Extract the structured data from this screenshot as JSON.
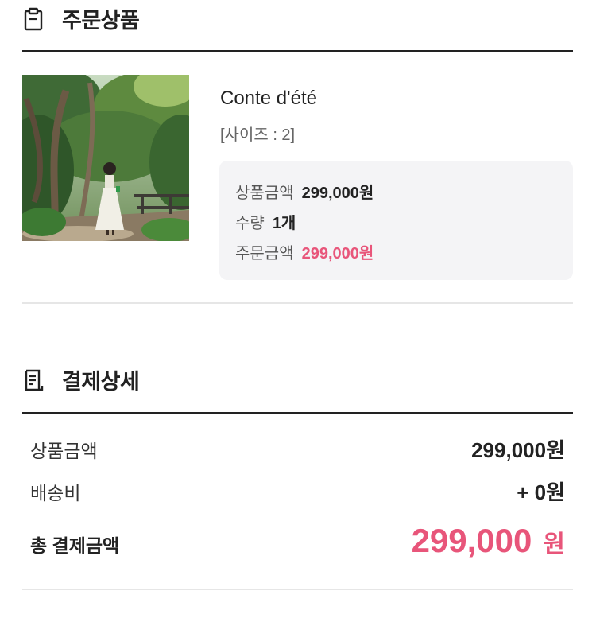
{
  "order_section": {
    "title": "주문상품",
    "icon": "clipboard-icon"
  },
  "item": {
    "name": "Conte d'été",
    "option": "[사이즈 : 2]",
    "image": "product-photo",
    "product_price_label": "상품금액",
    "product_price": "299,000원",
    "quantity_label": "수량",
    "quantity": "1개",
    "order_price_label": "주문금액",
    "order_price": "299,000원"
  },
  "payment_section": {
    "title": "결제상세",
    "icon": "receipt-icon",
    "product_price_label": "상품금액",
    "product_price": "299,000원",
    "shipping_label": "배송비",
    "shipping": "+ 0원",
    "total_label": "총 결제금액",
    "total_amount": "299,000",
    "total_unit": "원"
  },
  "colors": {
    "accent": "#e8557a",
    "text": "#222222",
    "box_bg": "#f4f4f6",
    "divider": "#e6e6e6"
  }
}
